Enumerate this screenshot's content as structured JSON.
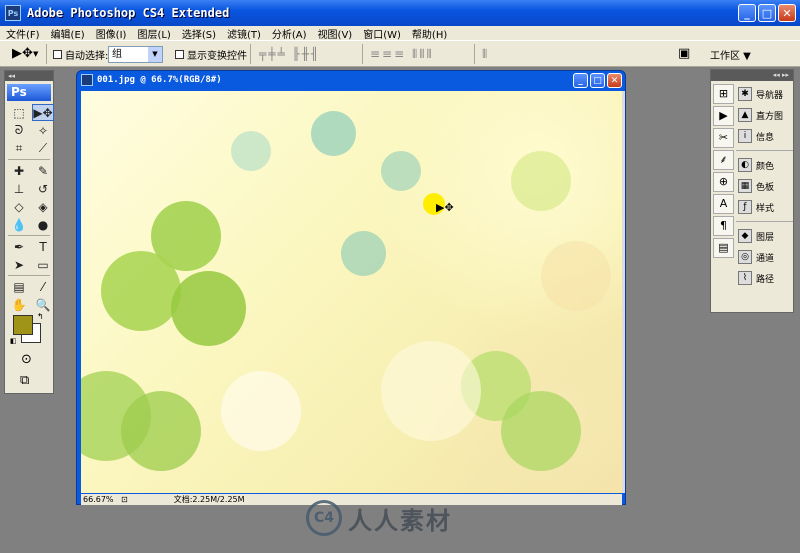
{
  "app": {
    "title": "Adobe Photoshop CS4 Extended",
    "logo": "Ps"
  },
  "menu": [
    "文件(F)",
    "编辑(E)",
    "图像(I)",
    "图层(L)",
    "选择(S)",
    "滤镜(T)",
    "分析(A)",
    "视图(V)",
    "窗口(W)",
    "帮助(H)"
  ],
  "options": {
    "auto_select_label": "自动选择:",
    "auto_select_value": "组",
    "show_transform_label": "显示变换控件",
    "workspace_label": "工作区 ▼"
  },
  "toolbox": {
    "logo": "Ps",
    "foreground_color": "#a09418",
    "background_color": "#ffffff"
  },
  "document": {
    "title": "001.jpg @ 66.7%(RGB/8#)",
    "zoom": "66.67%",
    "doc_size": "文档:2.25M/2.25M"
  },
  "panels": {
    "group1": [
      "导航器",
      "直方图",
      "信息"
    ],
    "group2": [
      "颜色",
      "色板",
      "样式"
    ],
    "group3": [
      "图层",
      "通道",
      "路径"
    ]
  },
  "watermark": {
    "logo_text": "C4",
    "text": "人人素材"
  }
}
